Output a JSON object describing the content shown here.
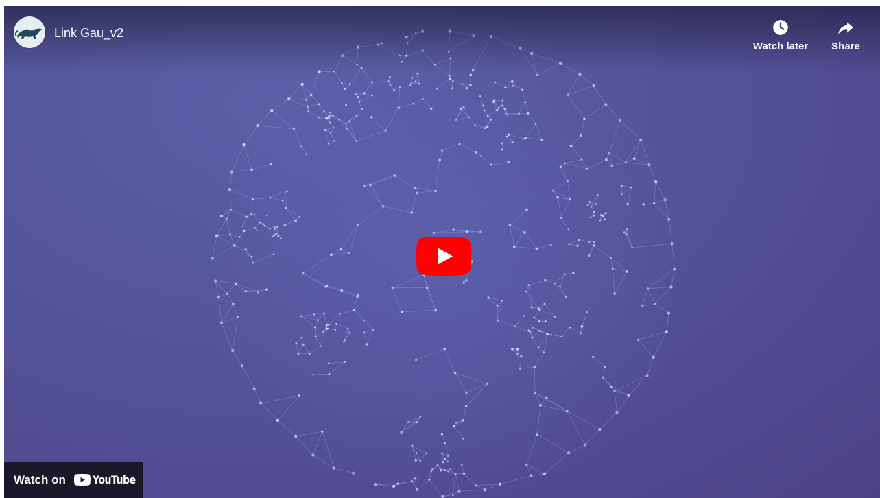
{
  "video": {
    "title": "Link Gau_v2",
    "channel_avatar_icon": "panther-icon"
  },
  "actions": {
    "watch_later": {
      "label": "Watch later",
      "icon": "clock-icon"
    },
    "share": {
      "label": "Share",
      "icon": "share-arrow-icon"
    }
  },
  "watch_on": {
    "label": "Watch on",
    "brand": "YouTube",
    "icon": "youtube-logo-icon"
  },
  "colors": {
    "play_red": "#ff0000",
    "bg_light": "#5a5fa6",
    "bg_dark": "#4d4288",
    "node": "#c9cdff",
    "link": "#aab1ff"
  }
}
